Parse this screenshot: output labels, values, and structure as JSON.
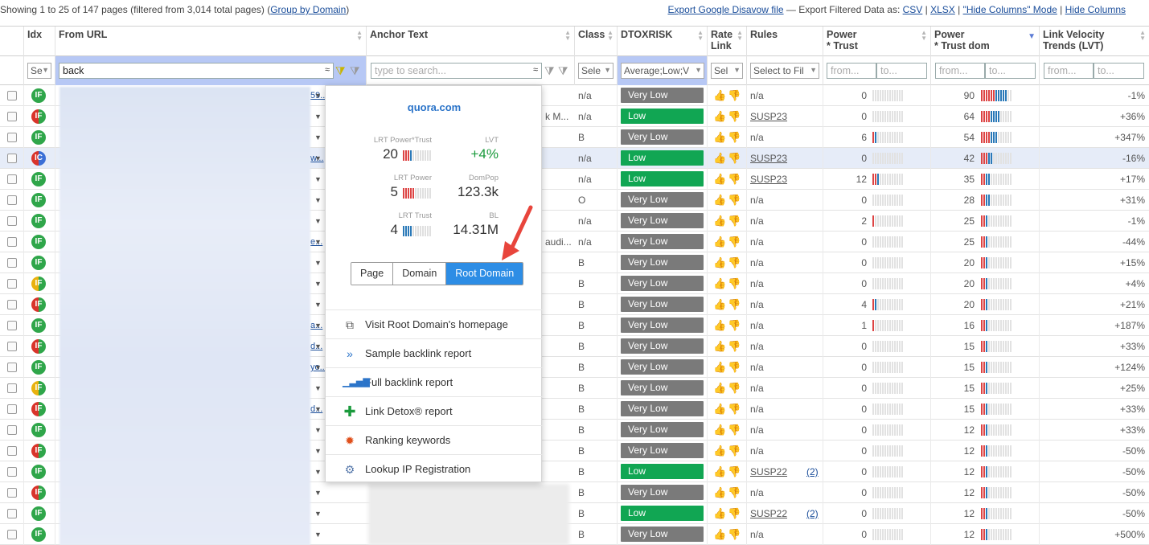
{
  "topbar": {
    "showing": "Showing 1 to 25 of 147 pages (filtered from 3,014 total pages) (",
    "group_by": "Group by Domain",
    "close_paren": ")",
    "export_disavow": "Export Google Disavow file",
    "export_label": " — Export Filtered Data as: ",
    "csv": "CSV",
    "sep": " | ",
    "xlsx": "XLSX",
    "hide_mode": "\"Hide Columns\" Mode",
    "hide_columns": "Hide Columns"
  },
  "headers": {
    "idx": "Idx",
    "from_url": "From URL",
    "anchor": "Anchor Text",
    "class": "Class",
    "dtox": "DTOXRISK",
    "rate1": "Rate",
    "rate2": "Link",
    "rules": "Rules",
    "pt1": "Power",
    "pt2": "* Trust",
    "ptd1": "Power",
    "ptd2": "* Trust dom",
    "lvt1": "Link Velocity",
    "lvt2": "Trends (LVT)"
  },
  "filters": {
    "idx_sel": "Se",
    "from_url_value": "back",
    "anchor_placeholder": "type to search...",
    "class_sel": "Sele",
    "dtox_sel": "Average;Low;V",
    "rate_sel": "Sel",
    "rules_sel": "Select to Fil",
    "from": "from...",
    "to": "to...",
    "approx": "≈"
  },
  "popup": {
    "domain": "quora.com",
    "m1_label": "LRT Power*Trust",
    "m1_value": "20",
    "m2_label": "LVT",
    "m2_value": "+4%",
    "m3_label": "LRT Power",
    "m3_value": "5",
    "m4_label": "DomPop",
    "m4_value": "123.3k",
    "m5_label": "LRT Trust",
    "m5_value": "4",
    "m6_label": "BL",
    "m6_value": "14.31M",
    "seg_page": "Page",
    "seg_domain": "Domain",
    "seg_root": "Root Domain",
    "menu": [
      {
        "label": "Visit Root Domain's homepage",
        "icon": "external-link-icon"
      },
      {
        "label": "Sample backlink report",
        "icon": "double-chevron-icon"
      },
      {
        "label": "Full backlink report",
        "icon": "bar-chart-icon"
      },
      {
        "label": "Link Detox® report",
        "icon": "plus-cross-icon"
      },
      {
        "label": "Ranking keywords",
        "icon": "ranking-keywords-icon"
      },
      {
        "label": "Lookup IP Registration",
        "icon": "gear-icon"
      }
    ]
  },
  "rows": [
    {
      "badge": "IF",
      "bc": "g",
      "url": "59...",
      "anchor": "",
      "class": "n/a",
      "risk": "Very Low",
      "rk": "vl",
      "rules": "n/a",
      "rc": "",
      "pt": "0",
      "ptd": "90",
      "lvt": "-1%"
    },
    {
      "badge": "IF",
      "bc": "r",
      "url": "",
      "anchor": "k M...",
      "class": "n/a",
      "risk": "Low",
      "rk": "lo",
      "rules": "SUSP23",
      "rc": "",
      "pt": "0",
      "ptd": "64",
      "lvt": "+36%"
    },
    {
      "badge": "IF",
      "bc": "g",
      "url": "",
      "anchor": "",
      "class": "B",
      "risk": "Very Low",
      "rk": "vl",
      "rules": "n/a",
      "rc": "",
      "pt": "6",
      "ptd": "54",
      "lvt": "+347%"
    },
    {
      "badge": "IC",
      "bc": "b",
      "url": "w...",
      "anchor": "",
      "class": "n/a",
      "risk": "Low",
      "rk": "lo",
      "rules": "SUSP23",
      "rc": "",
      "pt": "0",
      "ptd": "42",
      "lvt": "-16%"
    },
    {
      "badge": "IF",
      "bc": "g",
      "url": "",
      "anchor": "",
      "class": "n/a",
      "risk": "Low",
      "rk": "lo",
      "rules": "SUSP23",
      "rc": "",
      "pt": "12",
      "ptd": "35",
      "lvt": "+17%"
    },
    {
      "badge": "IF",
      "bc": "g",
      "url": "",
      "anchor": "",
      "class": "O",
      "risk": "Very Low",
      "rk": "vl",
      "rules": "n/a",
      "rc": "",
      "pt": "0",
      "ptd": "28",
      "lvt": "+31%"
    },
    {
      "badge": "IF",
      "bc": "g",
      "url": "",
      "anchor": "",
      "class": "n/a",
      "risk": "Very Low",
      "rk": "vl",
      "rules": "n/a",
      "rc": "",
      "pt": "2",
      "ptd": "25",
      "lvt": "-1%"
    },
    {
      "badge": "IF",
      "bc": "g",
      "url": "e...",
      "anchor": "audi...",
      "class": "n/a",
      "risk": "Very Low",
      "rk": "vl",
      "rules": "n/a",
      "rc": "",
      "pt": "0",
      "ptd": "25",
      "lvt": "-44%"
    },
    {
      "badge": "IF",
      "bc": "g",
      "url": "",
      "anchor": "",
      "class": "B",
      "risk": "Very Low",
      "rk": "vl",
      "rules": "n/a",
      "rc": "",
      "pt": "0",
      "ptd": "20",
      "lvt": "+15%"
    },
    {
      "badge": "IF",
      "bc": "y",
      "url": "",
      "anchor": "",
      "class": "B",
      "risk": "Very Low",
      "rk": "vl",
      "rules": "n/a",
      "rc": "",
      "pt": "0",
      "ptd": "20",
      "lvt": "+4%"
    },
    {
      "badge": "IF",
      "bc": "r",
      "url": "",
      "anchor": "",
      "class": "B",
      "risk": "Very Low",
      "rk": "vl",
      "rules": "n/a",
      "rc": "",
      "pt": "4",
      "ptd": "20",
      "lvt": "+21%"
    },
    {
      "badge": "IF",
      "bc": "g",
      "url": "a...",
      "anchor": "",
      "class": "B",
      "risk": "Very Low",
      "rk": "vl",
      "rules": "n/a",
      "rc": "",
      "pt": "1",
      "ptd": "16",
      "lvt": "+187%"
    },
    {
      "badge": "IF",
      "bc": "r",
      "url": "d...",
      "anchor": "",
      "class": "B",
      "risk": "Very Low",
      "rk": "vl",
      "rules": "n/a",
      "rc": "",
      "pt": "0",
      "ptd": "15",
      "lvt": "+33%"
    },
    {
      "badge": "IF",
      "bc": "g",
      "url": "yo...",
      "anchor": "",
      "class": "B",
      "risk": "Very Low",
      "rk": "vl",
      "rules": "n/a",
      "rc": "",
      "pt": "0",
      "ptd": "15",
      "lvt": "+124%"
    },
    {
      "badge": "IF",
      "bc": "y",
      "url": "",
      "anchor": "",
      "class": "B",
      "risk": "Very Low",
      "rk": "vl",
      "rules": "n/a",
      "rc": "",
      "pt": "0",
      "ptd": "15",
      "lvt": "+25%"
    },
    {
      "badge": "IF",
      "bc": "r",
      "url": "d...",
      "anchor": "",
      "class": "B",
      "risk": "Very Low",
      "rk": "vl",
      "rules": "n/a",
      "rc": "",
      "pt": "0",
      "ptd": "15",
      "lvt": "+33%"
    },
    {
      "badge": "IF",
      "bc": "g",
      "url": "",
      "anchor": "",
      "class": "B",
      "risk": "Very Low",
      "rk": "vl",
      "rules": "n/a",
      "rc": "",
      "pt": "0",
      "ptd": "12",
      "lvt": "+33%"
    },
    {
      "badge": "IF",
      "bc": "r",
      "url": "",
      "anchor": "",
      "class": "B",
      "risk": "Very Low",
      "rk": "vl",
      "rules": "n/a",
      "rc": "",
      "pt": "0",
      "ptd": "12",
      "lvt": "-50%"
    },
    {
      "badge": "IF",
      "bc": "g",
      "url": "",
      "anchor": "",
      "class": "B",
      "risk": "Low",
      "rk": "lo",
      "rules": "SUSP22",
      "rc": "(2)",
      "pt": "0",
      "ptd": "12",
      "lvt": "-50%"
    },
    {
      "badge": "IF",
      "bc": "r",
      "url": "",
      "anchor": "",
      "class": "B",
      "risk": "Very Low",
      "rk": "vl",
      "rules": "n/a",
      "rc": "",
      "pt": "0",
      "ptd": "12",
      "lvt": "-50%"
    },
    {
      "badge": "IF",
      "bc": "g",
      "url": "",
      "anchor": "",
      "class": "B",
      "risk": "Low",
      "rk": "lo",
      "rules": "SUSP22",
      "rc": "(2)",
      "pt": "0",
      "ptd": "12",
      "lvt": "-50%"
    },
    {
      "badge": "IF",
      "bc": "g",
      "url": "",
      "anchor": "",
      "class": "B",
      "risk": "Very Low",
      "rk": "vl",
      "rules": "n/a",
      "rc": "",
      "pt": "0",
      "ptd": "12",
      "lvt": "+500%"
    }
  ]
}
